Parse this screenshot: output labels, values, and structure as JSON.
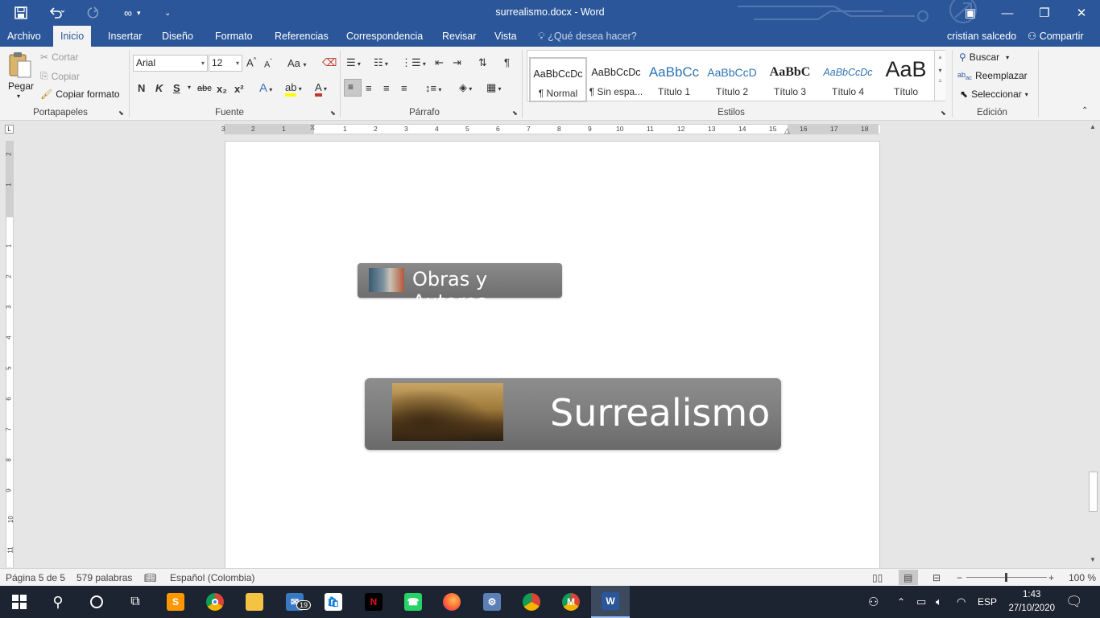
{
  "window": {
    "title": "surrealismo.docx - Word",
    "controls": {
      "ribbon_display": "▣",
      "minimize": "—",
      "restore": "❐",
      "close": "✕"
    }
  },
  "quick_access": {
    "save": "save-icon",
    "undo": "undo-icon",
    "redo": "redo-icon",
    "customize": "customize-icon"
  },
  "tabs": [
    {
      "label": "Archivo"
    },
    {
      "label": "Inicio",
      "active": true
    },
    {
      "label": "Insertar"
    },
    {
      "label": "Diseño"
    },
    {
      "label": "Formato"
    },
    {
      "label": "Referencias"
    },
    {
      "label": "Correspondencia"
    },
    {
      "label": "Revisar"
    },
    {
      "label": "Vista"
    }
  ],
  "tell_me": "¿Qué desea hacer?",
  "user": "cristian salcedo",
  "share": "Compartir",
  "clipboard": {
    "paste": "Pegar",
    "cut": "Cortar",
    "copy": "Copiar",
    "format_painter": "Copiar formato",
    "group": "Portapapeles"
  },
  "font": {
    "name": "Arial",
    "size": "12",
    "group": "Fuente",
    "bold": "N",
    "italic": "K",
    "underline": "S",
    "strike": "abc",
    "subscript": "x₂",
    "superscript": "x²",
    "grow": "A",
    "shrink": "A",
    "case": "Aa"
  },
  "paragraph": {
    "group": "Párrafo"
  },
  "styles": {
    "group": "Estilos",
    "items": [
      {
        "preview": "AaBbCcDc",
        "name": "¶ Normal"
      },
      {
        "preview": "AaBbCcDc",
        "name": "¶ Sin espa..."
      },
      {
        "preview": "AaBbCc",
        "name": "Título 1"
      },
      {
        "preview": "AaBbCcD",
        "name": "Título 2"
      },
      {
        "preview": "AaBbC",
        "name": "Título 3"
      },
      {
        "preview": "AaBbCcDc",
        "name": "Título 4"
      },
      {
        "preview": "AaB",
        "name": "Título"
      }
    ]
  },
  "editing": {
    "group": "Edición",
    "find": "Buscar",
    "replace": "Reemplazar",
    "select": "Seleccionar"
  },
  "ruler": {
    "numbers": [
      "3",
      "2",
      "1",
      "1",
      "2",
      "3",
      "4",
      "5",
      "6",
      "7",
      "8",
      "9",
      "10",
      "11",
      "12",
      "13",
      "14",
      "15",
      "16",
      "17",
      "18"
    ],
    "vnumbers": [
      "2",
      "1",
      "1",
      "2",
      "3",
      "4",
      "5",
      "6",
      "7",
      "8",
      "9",
      "10",
      "11"
    ]
  },
  "document": {
    "button1": "Obras y Autores",
    "button2": "Surrealismo"
  },
  "status": {
    "page": "Página 5 de 5",
    "words": "579 palabras",
    "language": "Español (Colombia)",
    "zoom": "100 %"
  },
  "taskbar": {
    "mail_badge": "19",
    "language": "ESP",
    "time": "1:43",
    "date": "27/10/2020"
  }
}
